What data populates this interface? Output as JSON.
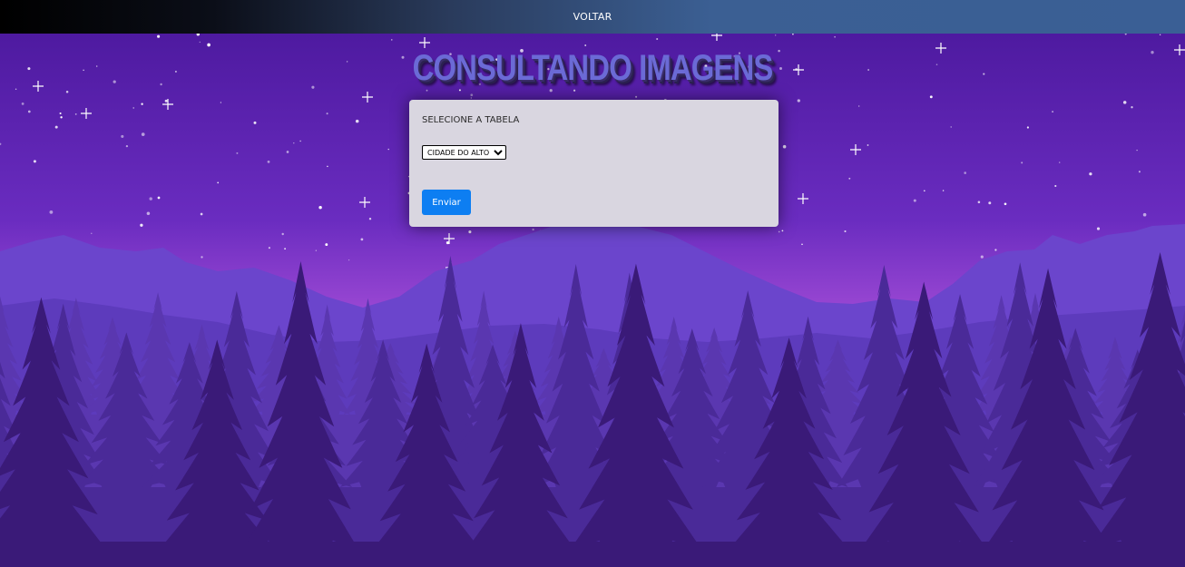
{
  "header": {
    "back_link": "VOLTAR"
  },
  "page": {
    "title": "CONSULTANDO IMAGENS"
  },
  "form": {
    "label": "SELECIONE A TABELA",
    "select": {
      "selected": "CIDADE DO ALTO",
      "options": [
        "CIDADE DO ALTO"
      ]
    },
    "submit_label": "Enviar"
  },
  "colors": {
    "sky_top": "#5a22a8",
    "sky_glow": "#c25fe0",
    "mountain": "#6a3fc8",
    "tree_far": "#5a37b0",
    "tree_near": "#3a1a78",
    "card_bg": "#d9d6e0",
    "button": "#0d7ef2",
    "title": "#6b6ad6"
  }
}
